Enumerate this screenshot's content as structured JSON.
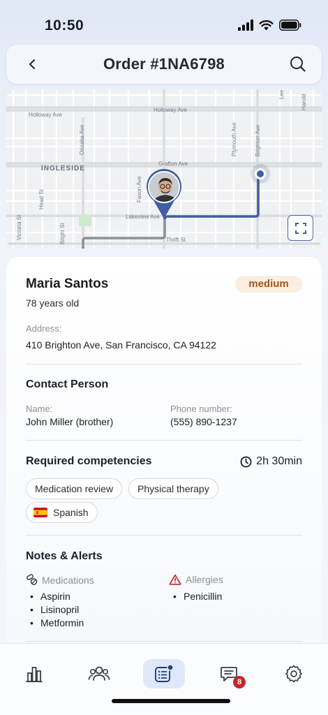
{
  "status_bar": {
    "time": "10:50"
  },
  "header": {
    "title": "Order #1NA6798"
  },
  "map": {
    "streets": {
      "holloway_w": "Holloway Ave",
      "holloway_e": "Holloway Ave",
      "grafton": "Grafton Ave",
      "lakeview": "Lakeview Ave",
      "thrift": "Thrift St",
      "orizaba": "Orizaba Ave",
      "bright": "Bright St",
      "head": "Head St",
      "victoria": "Victoria St",
      "faxon": "Faxon Ave",
      "plymouth": "Plymouth Ave",
      "brighton": "Brighton Ave",
      "lee": "Lee",
      "harold": "Harold"
    },
    "district": "INGLESIDE"
  },
  "patient": {
    "name": "Maria Santos",
    "priority": "medium",
    "age": "78 years old",
    "address_label": "Address:",
    "address": "410 Brighton Ave, San Francisco, CA 94122"
  },
  "contact": {
    "title": "Contact Person",
    "name_label": "Name:",
    "name": "John Miller (brother)",
    "phone_label": "Phone number:",
    "phone": "(555) 890-1237"
  },
  "competencies": {
    "title": "Required competencies",
    "duration": "2h 30min",
    "chips": [
      "Medication review",
      "Physical therapy"
    ],
    "language": "Spanish"
  },
  "notes": {
    "title": "Notes & Alerts",
    "medications_label": "Medications",
    "medications": [
      "Aspirin",
      "Lisinopril",
      "Metformin"
    ],
    "allergies_label": "Allergies",
    "allergies": [
      "Penicillin"
    ]
  },
  "nav": {
    "messages_badge": "8"
  },
  "colors": {
    "accent": "#3f5ea3",
    "priority_bg": "#fbeee0",
    "priority_text": "#a3561a",
    "alert_red": "#c3262b"
  },
  "icons": [
    "back-icon",
    "search-icon",
    "fullscreen-icon",
    "clock-icon",
    "spain-flag-icon",
    "pills-icon",
    "warning-icon",
    "chart-icon",
    "users-icon",
    "orders-icon",
    "messages-icon",
    "settings-icon"
  ]
}
